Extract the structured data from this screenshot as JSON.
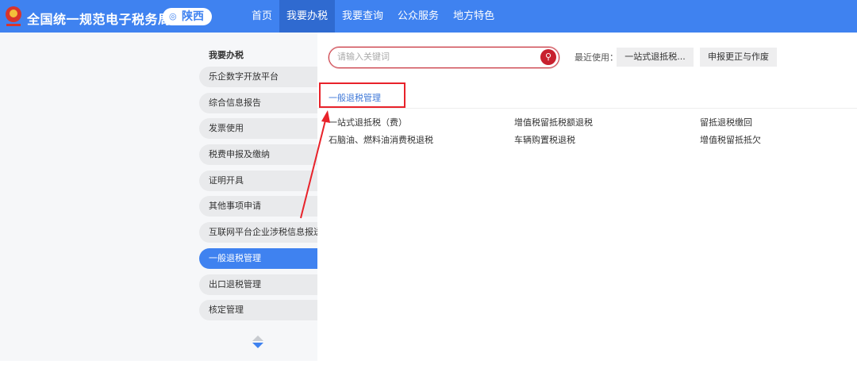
{
  "header": {
    "title": "全国统一规范电子税务局",
    "region": "陕西",
    "nav": [
      "首页",
      "我要办税",
      "我要查询",
      "公众服务",
      "地方特色"
    ],
    "active_nav": 1
  },
  "sidebar": {
    "title": "我要办税",
    "items": [
      "乐企数字开放平台",
      "综合信息报告",
      "发票使用",
      "税费申报及缴纳",
      "证明开具",
      "其他事项申请",
      "互联网平台企业涉税信息报送",
      "一般退税管理",
      "出口退税管理",
      "核定管理"
    ],
    "active": 7
  },
  "search": {
    "placeholder": "请输入关键词",
    "value": ""
  },
  "recent": {
    "label": "最近使用：",
    "items": [
      "一站式退抵税...",
      "申报更正与作废"
    ]
  },
  "category": {
    "title": "一般退税管理",
    "items": [
      "一站式退抵税（费）",
      "增值税留抵税额退税",
      "留抵退税缴回",
      "石脑油、燃料油消费税退税",
      "车辆购置税退税",
      "增值税留抵抵欠"
    ]
  },
  "colors": {
    "brand": "#3f82f0",
    "annotation": "#e8222a"
  }
}
